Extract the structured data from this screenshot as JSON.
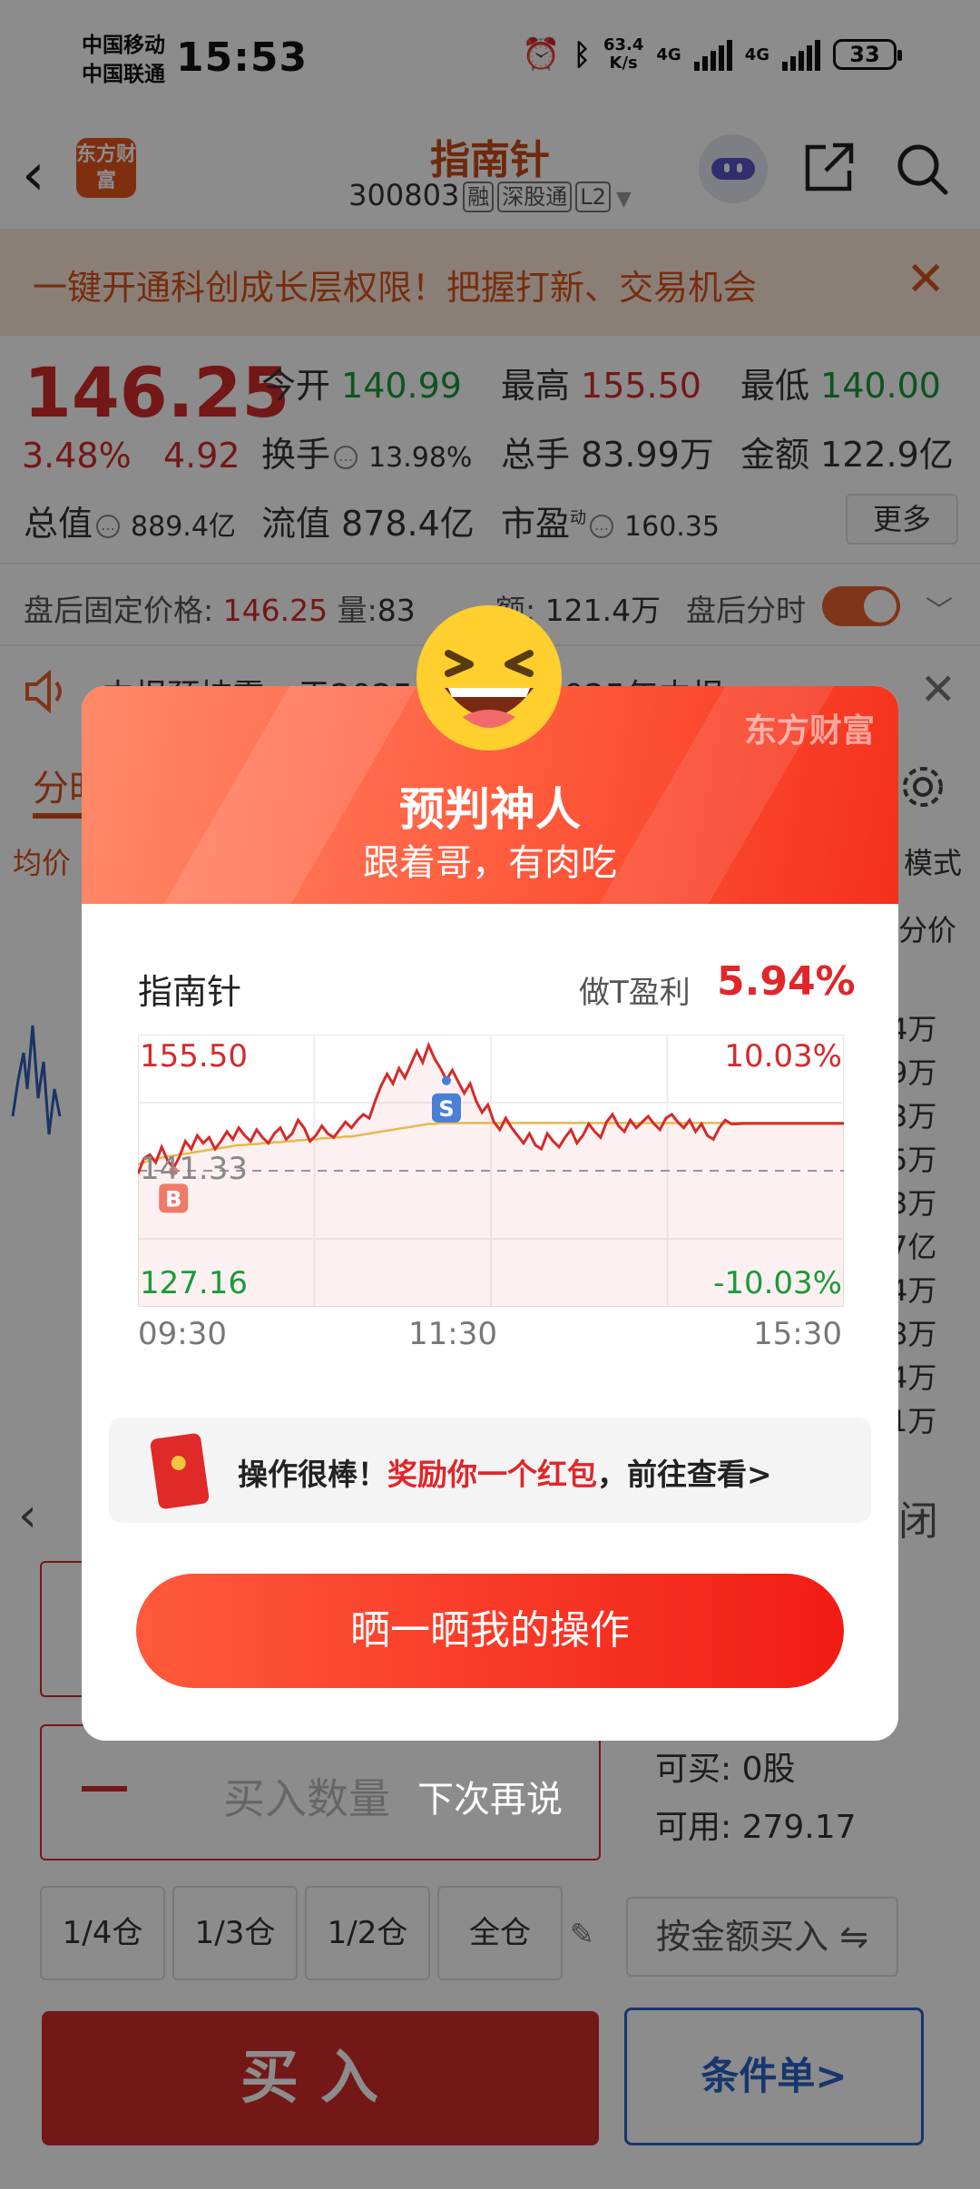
{
  "status_bar": {
    "carrier1": "中国移动",
    "carrier2": "中国联通",
    "time": "15:53",
    "net_speed_value": "63.4",
    "net_speed_unit": "K/s",
    "net1": "4G",
    "net2": "4G",
    "battery": "33"
  },
  "header": {
    "logo_text": "东方财富",
    "stock_name": "指南针",
    "stock_code": "300803",
    "tags": [
      "融",
      "深股通",
      "L2"
    ]
  },
  "banner": {
    "text": "一键开通科创成长层权限！把握打新、交易机会"
  },
  "quote": {
    "price": "146.25",
    "change_pct": "3.48%",
    "change": "4.92",
    "open_label": "今开",
    "open": "140.99",
    "high_label": "最高",
    "high": "155.50",
    "low_label": "最低",
    "low": "140.00",
    "turnover_label": "换手",
    "turnover": "13.98%",
    "volume_label": "总手",
    "volume": "83.99万",
    "amount_label": "金额",
    "amount": "122.9亿",
    "mktcap_label": "总值",
    "mktcap": "889.4亿",
    "float_label": "流值",
    "float_cap": "878.4亿",
    "pe_label": "市盈",
    "pe_sup": "动",
    "pe": "160.35",
    "more": "更多"
  },
  "after_hours": {
    "label": "盘后固定价格:",
    "price": "146.25",
    "vol_label": "量:",
    "vol": "83",
    "amt_label": "额:",
    "amt": "121.4万",
    "time_label": "盘后分时"
  },
  "notice": {
    "text": "中报预披露：于2025年...披露2025年中报"
  },
  "background": {
    "tab": "分时",
    "avg_label": "均价",
    "mode": "模式",
    "split": "分价",
    "right_values": [
      "4万",
      "9万",
      "3万",
      "5万",
      "3万",
      "7亿",
      "4万",
      "8万",
      "4万",
      "1万"
    ],
    "close": "闭"
  },
  "trade": {
    "qty_placeholder": "买入数量",
    "can_buy": "可买:  0股",
    "available": "可用:  279.17",
    "positions": [
      "1/4仓",
      "1/3仓",
      "1/2仓",
      "全仓"
    ],
    "amount_buy": "按金额买入 ⇋",
    "buy": "买入",
    "conditional": "条件单>"
  },
  "dialog": {
    "brand": "东方财富",
    "title": "预判神人",
    "subtitle": "跟着哥，有肉吃",
    "stock": "指南针",
    "profit_label": "做T盈利",
    "profit": "5.94%",
    "reward_prefix": "操作很棒！",
    "reward_highlight": "奖励你一个红包",
    "reward_suffix": "，前往查看>",
    "share_button": "晒一晒我的操作",
    "later": "下次再说",
    "colors": {
      "accent": "#f4301c",
      "up": "#d42a2a",
      "down": "#1a9a3a",
      "avg_line": "#e8b84a"
    }
  },
  "chart_data": {
    "type": "line",
    "title": "",
    "xlabel": "",
    "ylabel": "",
    "x_ticks": [
      "09:30",
      "11:30",
      "15:30"
    ],
    "y_left_labels": {
      "top": "155.50",
      "mid": "141.33",
      "bottom": "127.16"
    },
    "y_right_labels": {
      "top": "10.03%",
      "bottom": "-10.03%"
    },
    "ylim": [
      127.16,
      155.5
    ],
    "prev_close": 141.33,
    "markers": [
      {
        "label": "B",
        "index": 6,
        "price": 141.3
      },
      {
        "label": "S",
        "index": 52,
        "price": 150.7
      }
    ],
    "series": [
      {
        "values": [
          141.0,
          142.6,
          143.0,
          142.2,
          143.8,
          142.4,
          141.6,
          142.8,
          144.4,
          143.6,
          145.0,
          144.2,
          144.8,
          143.6,
          144.4,
          145.4,
          144.6,
          145.8,
          145.0,
          144.4,
          145.6,
          144.8,
          144.2,
          145.2,
          145.8,
          144.6,
          145.2,
          146.6,
          145.8,
          144.4,
          145.0,
          146.0,
          145.2,
          144.8,
          145.6,
          146.4,
          145.8,
          146.6,
          147.2,
          146.8,
          148.6,
          150.2,
          151.4,
          150.4,
          152.0,
          151.0,
          152.4,
          153.8,
          152.6,
          154.4,
          153.0,
          152.0,
          150.8,
          151.8,
          150.6,
          149.4,
          150.4,
          148.6,
          147.4,
          148.2,
          146.4,
          145.6,
          146.8,
          145.8,
          145.0,
          144.2,
          145.2,
          144.0,
          143.6,
          145.2,
          144.4,
          143.8,
          144.8,
          145.6,
          144.2,
          145.0,
          146.2,
          145.4,
          144.8,
          146.4,
          147.2,
          146.0,
          145.4,
          146.6,
          145.8,
          146.4,
          147.0,
          146.2,
          145.6,
          146.8,
          147.2,
          146.4,
          145.8,
          146.6,
          145.4,
          146.2,
          145.0,
          144.6,
          145.8,
          146.6,
          146.2,
          146.2,
          146.25,
          146.25,
          146.25,
          146.25,
          146.25,
          146.25,
          146.25,
          146.25,
          146.25,
          146.25,
          146.25,
          146.25,
          146.25,
          146.25,
          146.25,
          146.25,
          146.25,
          146.25
        ]
      },
      {
        "name": "均价",
        "values": [
          142.0,
          142.2,
          142.4,
          142.5,
          142.7,
          142.8,
          142.9,
          143.0,
          143.1,
          143.2,
          143.3,
          143.4,
          143.5,
          143.6,
          143.7,
          143.8,
          143.9,
          144.0,
          144.0,
          144.1,
          144.1,
          144.2,
          144.2,
          144.3,
          144.3,
          144.4,
          144.4,
          144.5,
          144.5,
          144.6,
          144.6,
          144.7,
          144.7,
          144.8,
          144.8,
          144.9,
          144.9,
          145.0,
          145.1,
          145.2,
          145.3,
          145.4,
          145.5,
          145.6,
          145.7,
          145.8,
          145.9,
          146.0,
          146.1,
          146.2,
          146.2,
          146.3,
          146.3,
          146.3,
          146.3,
          146.3,
          146.3,
          146.3,
          146.3,
          146.3,
          146.3,
          146.3,
          146.3,
          146.3,
          146.3,
          146.3,
          146.3,
          146.3,
          146.3,
          146.3,
          146.3,
          146.3,
          146.3,
          146.3,
          146.3,
          146.3,
          146.3,
          146.3,
          146.3,
          146.3,
          146.3,
          146.3,
          146.3,
          146.3,
          146.3,
          146.3,
          146.3,
          146.3,
          146.3,
          146.3,
          146.3,
          146.3,
          146.3,
          146.3,
          146.3,
          146.3,
          146.3,
          146.3,
          146.3,
          146.3,
          146.3,
          146.3,
          146.3,
          146.3,
          146.3,
          146.3,
          146.3,
          146.3,
          146.3,
          146.3,
          146.3,
          146.3,
          146.3,
          146.3,
          146.3,
          146.3,
          146.3,
          146.3,
          146.3,
          146.3,
          146.3
        ]
      }
    ]
  }
}
